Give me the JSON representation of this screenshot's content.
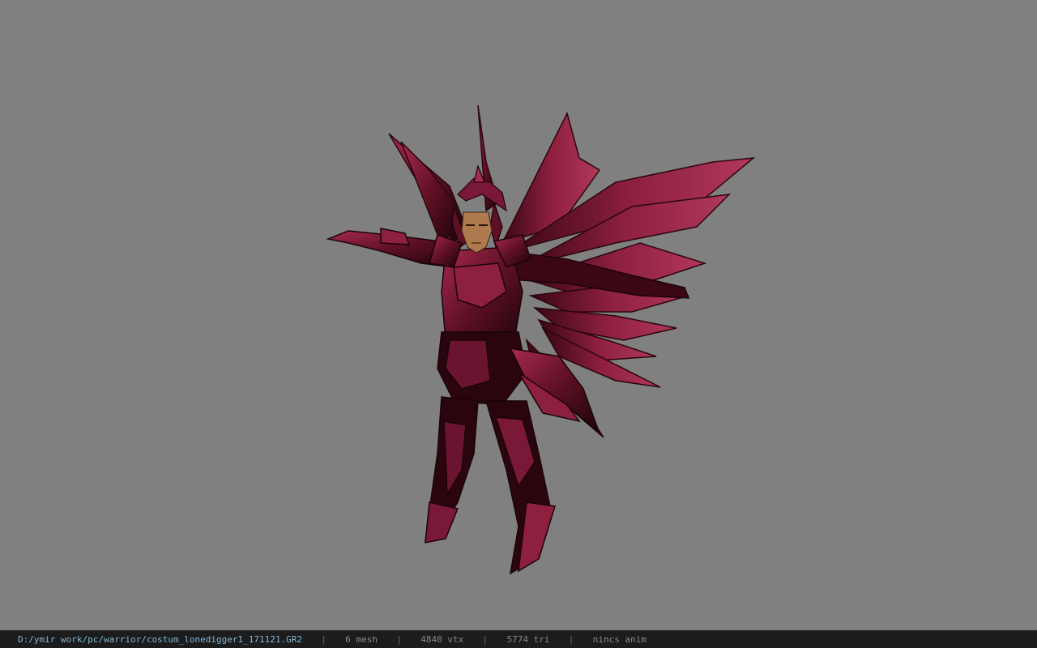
{
  "viewer": {
    "background_color": "#808080",
    "model_primary_color": "#5e1024",
    "model_highlight_color": "#a8294f",
    "model_dark_color": "#1a0308",
    "skin_color": "#b07a4f"
  },
  "statusbar": {
    "file_path": "D:/ymir work/pc/warrior/costum_lonedigger1_171121.GR2",
    "separator": "|",
    "mesh_count": "6 mesh",
    "vertex_count": "4840 vtx",
    "triangle_count": "5774 tri",
    "anim_status": "nincs anim"
  }
}
